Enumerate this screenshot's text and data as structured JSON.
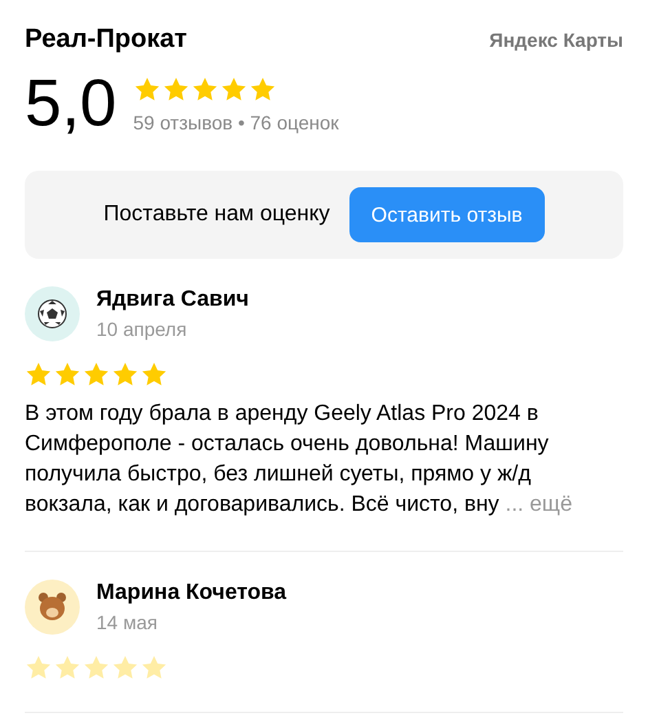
{
  "header": {
    "title": "Реал-Прокат",
    "brand": "Яндекс Карты"
  },
  "rating": {
    "score": "5,0",
    "stars": 5,
    "reviews_count": "59 отзывов",
    "separator": "•",
    "ratings_count": "76 оценок"
  },
  "prompt": {
    "text": "Поставьте нам оценку",
    "button": "Оставить отзыв"
  },
  "reviews": [
    {
      "avatar": {
        "kind": "ball"
      },
      "name": "Ядвига Савич",
      "date": "10 апреля",
      "stars": 5,
      "faded": false,
      "text": "В этом году брала в аренду Geely Atlas Pro 2024 в Симферополе - осталась очень довольна! Машину получила быстро, без лишней суеты, прямо у ж/д вокзала, как и договаривались. Всё чисто, вну",
      "more": "... ещё"
    },
    {
      "avatar": {
        "kind": "bear"
      },
      "name": "Марина Кочетова",
      "date": "14 мая",
      "stars": 5,
      "faded": true
    }
  ]
}
